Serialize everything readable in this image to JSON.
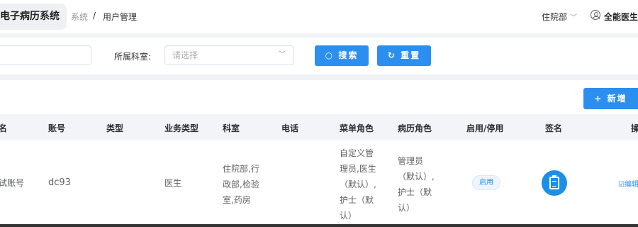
{
  "header": {
    "app_title": "电子病历系统",
    "breadcrumb": [
      "系统",
      "/",
      "用户管理"
    ],
    "department": "住院部",
    "user_name": "全能医生"
  },
  "filters": {
    "dept_label": "所属科室:",
    "dept_placeholder": "请选择",
    "search_label": "搜索",
    "reset_label": "重置"
  },
  "toolbar": {
    "add_label": "+ 新增"
  },
  "table": {
    "columns": [
      "名",
      "账号",
      "类型",
      "业务类型",
      "科室",
      "电话",
      "菜单角色",
      "病历角色",
      "启用/停用",
      "签名",
      "操"
    ],
    "rows": [
      {
        "name": "试账号",
        "account": "dc93",
        "type": "",
        "business_type": "医生",
        "department": [
          "住院部,行",
          "政部,检验",
          "室,药房"
        ],
        "phone": "",
        "menu_role": [
          "自定义管",
          "理员,医生",
          "（默认）,",
          "护士（默",
          "认）"
        ],
        "record_role": [
          "管理员",
          "（默认）,",
          "护士（默",
          "认）"
        ],
        "status": "启用",
        "action": "编辑"
      }
    ]
  },
  "colors": {
    "primary": "#2b8ff0",
    "header_bg": "#f2f4f7"
  },
  "icons": [
    "chevron-down-icon",
    "user-circle-icon",
    "search-icon",
    "refresh-icon",
    "clipboard-icon",
    "edit-icon"
  ]
}
